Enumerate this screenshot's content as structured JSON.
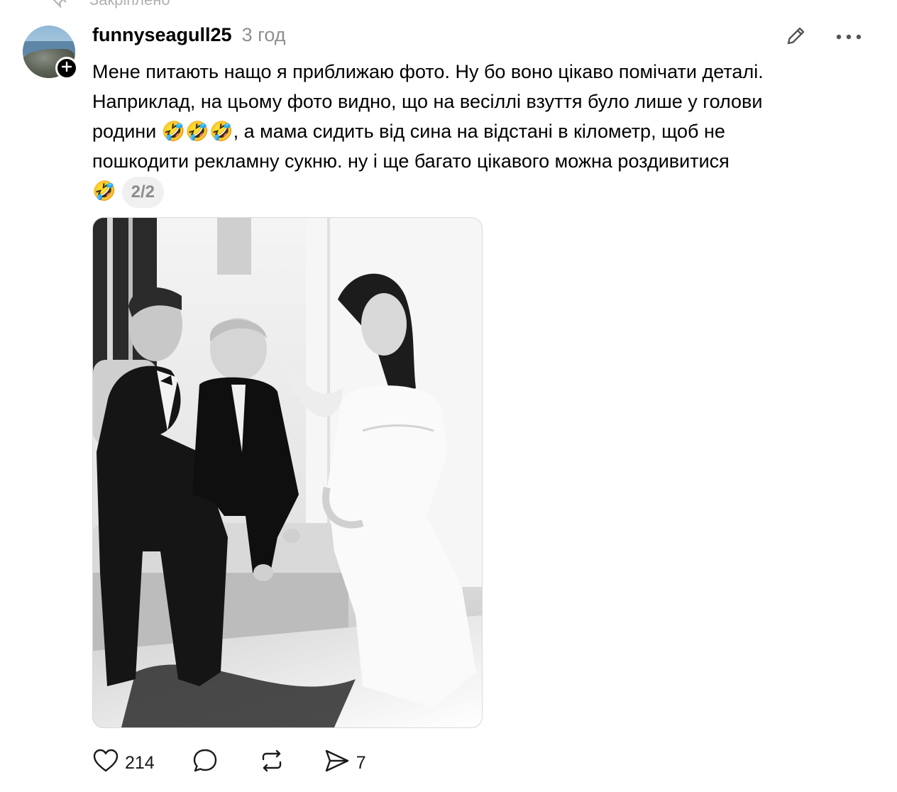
{
  "pinned": {
    "label": "Закріплено",
    "icon": "pin-icon"
  },
  "post": {
    "author": "funnyseagull25",
    "time": "3 год",
    "text_lines": [
      "Мене питають нащо я приближаю фото. Ну бо воно цікаво помічати деталі.",
      "Наприклад, на цьому фото видно, що на весіллі взуття було лише у голови",
      "родини 🤣🤣🤣, а мама сидить від сина на відстані в кілометр, щоб не",
      "пошкодити рекламну сукню. ну і ще багато цікавого можна роздивитися",
      "🤣"
    ],
    "page_indicator": "2/2",
    "image": {
      "description_icon": "wedding-family-photo"
    }
  },
  "actions": {
    "likes": "214",
    "comments": "",
    "reposts": "",
    "shares": "7"
  },
  "colors": {
    "text": "#000000",
    "muted": "#8f8f8f",
    "pill_bg": "#f0f0f0"
  }
}
